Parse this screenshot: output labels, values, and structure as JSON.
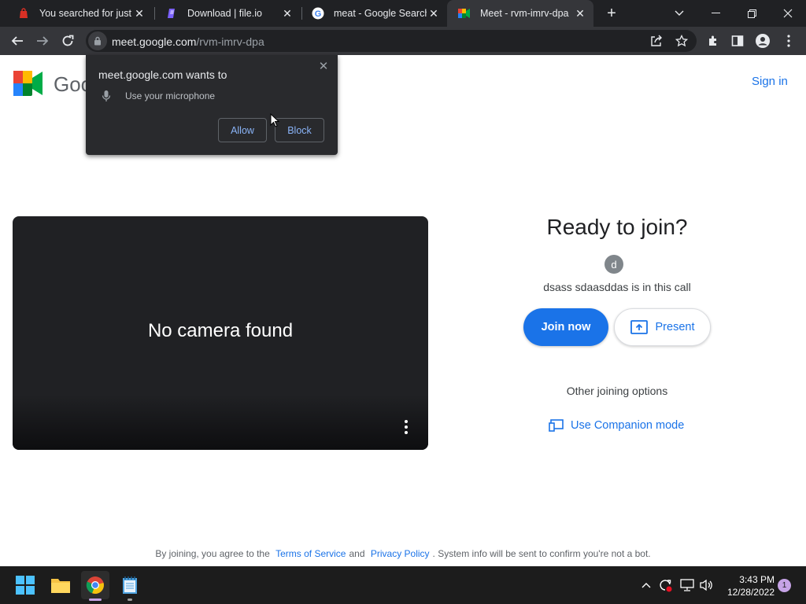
{
  "browser": {
    "tabs": [
      {
        "title": "You searched for just sl",
        "favicon": "red-bag-icon",
        "active": false
      },
      {
        "title": "Download | file.io",
        "favicon": "file-io-icon",
        "active": false
      },
      {
        "title": "meat - Google Search",
        "favicon": "google-icon",
        "active": false
      },
      {
        "title": "Meet - rvm-imrv-dpa",
        "favicon": "meet-icon",
        "active": true
      }
    ],
    "url_host": "meet.google.com",
    "url_path": "/rvm-imrv-dpa"
  },
  "permission_prompt": {
    "title": "meet.google.com wants to",
    "item": "Use your microphone",
    "allow_label": "Allow",
    "block_label": "Block"
  },
  "meet": {
    "logo_text": "Goo",
    "sign_in": "Sign in",
    "no_camera": "No camera found",
    "ready_title": "Ready to join?",
    "avatar_letter": "d",
    "in_call": "dsass sdaasddas is in this call",
    "join_label": "Join now",
    "present_label": "Present",
    "other_options": "Other joining options",
    "companion_label": "Use Companion mode",
    "footer": {
      "prefix": "By joining, you agree to the",
      "terms": "Terms of Service",
      "and": "and",
      "privacy": "Privacy Policy",
      "suffix": ". System info will be sent to confirm you're not a bot."
    }
  },
  "taskbar": {
    "time": "3:43 PM",
    "date": "12/28/2022",
    "notification_count": "1"
  },
  "colors": {
    "accent": "#1a73e8",
    "tabstrip": "#202124",
    "toolbar": "#35363a"
  }
}
